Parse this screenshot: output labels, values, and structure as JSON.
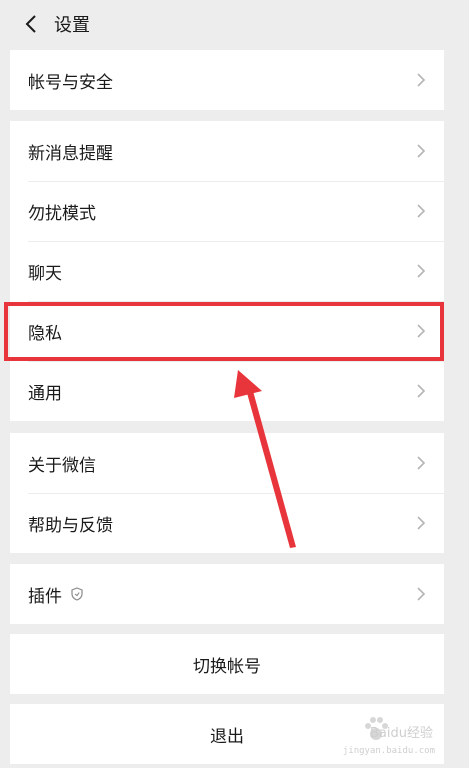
{
  "header": {
    "title": "设置",
    "back_icon": "chevron-left-icon"
  },
  "groups": [
    {
      "items": [
        {
          "label": "帐号与安全"
        }
      ]
    },
    {
      "items": [
        {
          "label": "新消息提醒"
        },
        {
          "label": "勿扰模式"
        },
        {
          "label": "聊天"
        },
        {
          "label": "隐私"
        },
        {
          "label": "通用"
        }
      ]
    },
    {
      "items": [
        {
          "label": "关于微信"
        },
        {
          "label": "帮助与反馈"
        }
      ]
    },
    {
      "items": [
        {
          "label": "插件",
          "icon": "shield-icon"
        }
      ]
    }
  ],
  "actions": {
    "switch_account": "切换帐号",
    "logout": "退出"
  },
  "annotation": {
    "highlight_color": "#e8353b"
  },
  "watermark": {
    "line1": "Baidu经验",
    "line2": "jingyan.baidu.com"
  }
}
